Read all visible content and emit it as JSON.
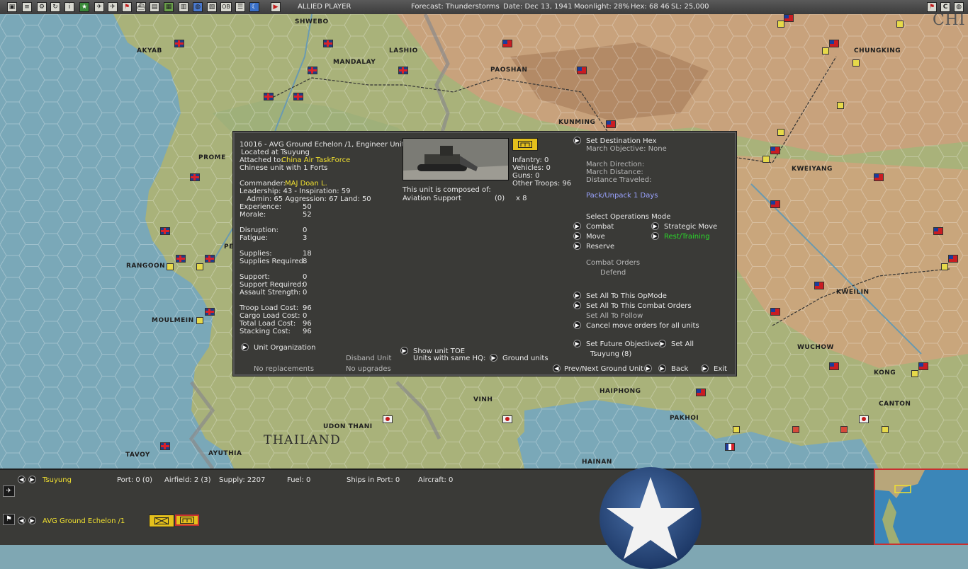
{
  "topbar": {
    "icons": [
      "window-icon",
      "document-icon",
      "gear-icon",
      "refresh-icon",
      "info-icon",
      "star-icon",
      "aircraft-icon",
      "aircraft-icon",
      "flag-icon",
      "ship-icon",
      "cargo-icon",
      "map-icon",
      "groups-icon",
      "globe-icon",
      "chart-icon",
      "ob-icon",
      "list-icon",
      "moon-icon",
      "play-icon"
    ],
    "ob_label": "OB",
    "player": "ALLIED PLAYER",
    "forecast": "Forecast: Thunderstorms",
    "date": "Date: Dec 13, 1941",
    "moonlight": "Moonlight: 28%",
    "hex": "Hex: 68  46",
    "sl": "SL: 25,000",
    "right_icons": [
      "flag-icon",
      "c-icon",
      "globe-icon",
      "close-icon"
    ],
    "right_c": "C"
  },
  "map": {
    "labels": [
      {
        "text": "SHWEBO"
      },
      {
        "text": "AKYAB"
      },
      {
        "text": "LASHIO"
      },
      {
        "text": "MANDALAY"
      },
      {
        "text": "PAOSHAN"
      },
      {
        "text": "KUNMING"
      },
      {
        "text": "CHUNGKING"
      },
      {
        "text": "KWEIYANG"
      },
      {
        "text": "PROME"
      },
      {
        "text": "RANGOON"
      },
      {
        "text": "MOULMEIN"
      },
      {
        "text": "KWEILIN"
      },
      {
        "text": "WUCHOW"
      },
      {
        "text": "HAIPHONG"
      },
      {
        "text": "PAKHOI"
      },
      {
        "text": "CANTON"
      },
      {
        "text": "UDON THANI"
      },
      {
        "text": "VINH"
      },
      {
        "text": "THAILAND"
      },
      {
        "text": "TAVOY"
      },
      {
        "text": "AYUTHIA"
      },
      {
        "text": "HAINAN"
      },
      {
        "text": "CHI"
      },
      {
        "text": "KONG"
      },
      {
        "text": "PE"
      }
    ]
  },
  "dialog": {
    "unit_title": "10016 - AVG Ground Echelon /1, Engineer Unit",
    "located": "Located at Tsuyung",
    "attached_label": "Attached to:",
    "attached_value": "China Air TaskForce",
    "forts": "Chinese unit with 1 Forts",
    "commander_label": "Commander:",
    "commander_value": "MAJ Doan L.",
    "leadership": "Leadership: 43 - Inspiration: 59",
    "admin": "Admin: 65  Aggression: 67  Land: 50",
    "stats1": [
      {
        "label": "Experience:",
        "value": "50"
      },
      {
        "label": "Morale:",
        "value": "52"
      }
    ],
    "stats2": [
      {
        "label": "Disruption:",
        "value": "0"
      },
      {
        "label": "Fatigue:",
        "value": "3"
      }
    ],
    "stats3": [
      {
        "label": "Supplies:",
        "value": "18"
      },
      {
        "label": "Supplies Required:",
        "value": "8"
      }
    ],
    "stats4": [
      {
        "label": "Support:",
        "value": "0"
      },
      {
        "label": "Support Required:",
        "value": "0"
      },
      {
        "label": "Assault Strength:",
        "value": "0"
      }
    ],
    "stats5": [
      {
        "label": "Troop Load Cost:",
        "value": "96"
      },
      {
        "label": "Cargo Load Cost:",
        "value": "0"
      },
      {
        "label": "Total Load Cost:",
        "value": "96"
      },
      {
        "label": "Stacking Cost:",
        "value": "96"
      }
    ],
    "unit_org": "Unit Organization",
    "disband": "Disband Unit",
    "no_replacements": "No replacements",
    "no_upgrades": "No upgrades",
    "badge_icon": "engineer-icon",
    "infantry": "Infantry: 0",
    "vehicles": "Vehicles: 0",
    "guns": "Guns: 0",
    "other_troops": "Other Troops: 96",
    "composed": "This unit is composed of:",
    "component_name": "Aviation Support",
    "component_count": "(0)",
    "component_qty": "x 8",
    "show_toe": "Show unit TOE",
    "units_same_hq": "Units with same HQ:",
    "ground_units": "Ground units",
    "set_dest": "Set Destination Hex",
    "march_obj": "March Objective: None",
    "march_dir": "March Direction:",
    "march_dist": "March Distance:",
    "dist_traveled": "Distance Traveled:",
    "pack": "Pack/Unpack 1 Days",
    "select_ops": "Select Operations Mode",
    "combat": "Combat",
    "move": "Move",
    "reserve": "Reserve",
    "strategic": "Strategic Move",
    "rest": "Rest/Training",
    "combat_orders": "Combat Orders",
    "defend": "Defend",
    "set_all_opmode": "Set All To This OpMode",
    "set_all_combat": "Set All To This Combat Orders",
    "set_all_follow": "Set All To Follow",
    "cancel_move": "Cancel move orders for all units",
    "future_obj": "Set Future Objective",
    "set_all": "Set All",
    "tsuyung8": "Tsuyung (8)",
    "prevnext": "Prev/Next Ground Unit",
    "back": "Back",
    "exit": "Exit"
  },
  "bottom": {
    "location": "Tsuyung",
    "port": "Port: 0 (0)",
    "airfield": "Airfield: 2 (3)",
    "supply": "Supply: 2207",
    "fuel": "Fuel: 0",
    "ships": "Ships in Port: 0",
    "aircraft": "Aircraft: 0",
    "unit_name": "AVG Ground Echelon /1"
  },
  "colors": {
    "accent_yellow": "#f0e030",
    "panel": "#3a3a37",
    "green": "#2ad82a",
    "blue_text": "#9aa3ff"
  }
}
